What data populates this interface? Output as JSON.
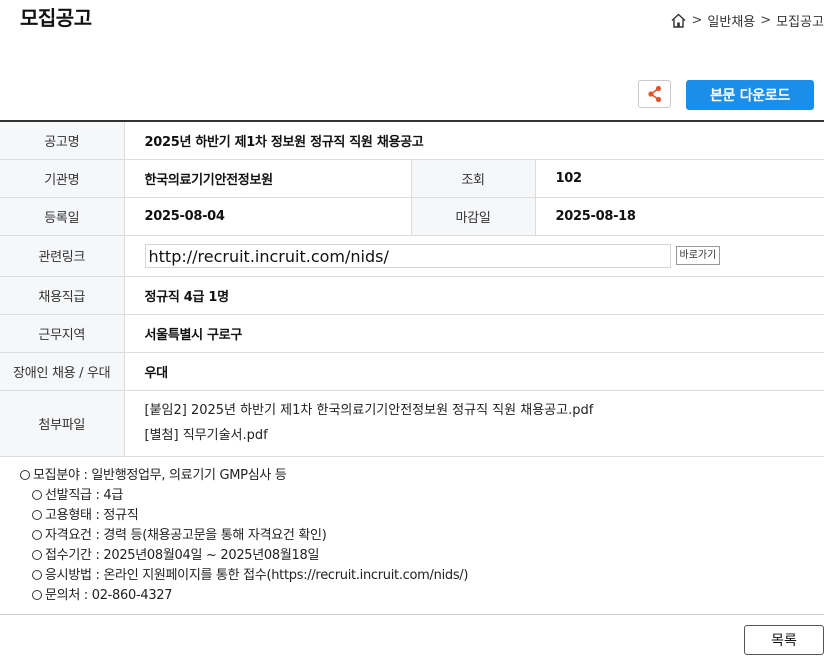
{
  "page_title": "모집공고",
  "breadcrumb": {
    "sep": ">",
    "items": [
      "일반채용",
      "모집공고"
    ]
  },
  "toolbar": {
    "download_label": "본문 다운로드"
  },
  "info": {
    "title_label": "공고명",
    "title_value": "2025년 하반기 제1차 정보원 정규직 직원 채용공고",
    "agency_label": "기관명",
    "agency_value": "한국의료기기안전정보원",
    "views_label": "조회",
    "views_value": "102",
    "reg_label": "등록일",
    "reg_value": "2025-08-04",
    "deadline_label": "마감일",
    "deadline_value": "2025-08-18",
    "link_label": "관련링크",
    "link_value": "http://recruit.incruit.com/nids/",
    "link_button": "바로가기",
    "grade_label": "채용직급",
    "grade_value": "정규직 4급 1명",
    "region_label": "근무지역",
    "region_value": "서울특별시 구로구",
    "disabled_label": "장애인 채용 / 우대",
    "disabled_value": "우대",
    "attach_label": "첨부파일",
    "attachments": [
      "[붙임2] 2025년 하반기 제1차 한국의료기기안전정보원 정규직 직원 채용공고.pdf",
      "[별첨] 직무기술서.pdf"
    ]
  },
  "details": [
    "모집분야 : 일반행정업무, 의료기기 GMP심사 등",
    "선발직급 : 4급",
    "고용형태 : 정규직",
    "자격요건 : 경력 등(채용공고문을 통해 자격요건 확인)",
    "접수기간 : 2025년08월04일 ~ 2025년08월18일",
    "응시방법 : 온라인 지원페이지를 통한 접수(https://recruit.incruit.com/nids/)",
    "문의처 : 02-860-4327"
  ],
  "footer": {
    "list_label": "목록"
  },
  "colors": {
    "accent": "#1a8ee8",
    "header_bg": "#f6f7f9",
    "border": "#dcdcdc",
    "share_icon": "#e2552b"
  },
  "icons": {
    "home": "home-icon",
    "share": "share-icon"
  }
}
